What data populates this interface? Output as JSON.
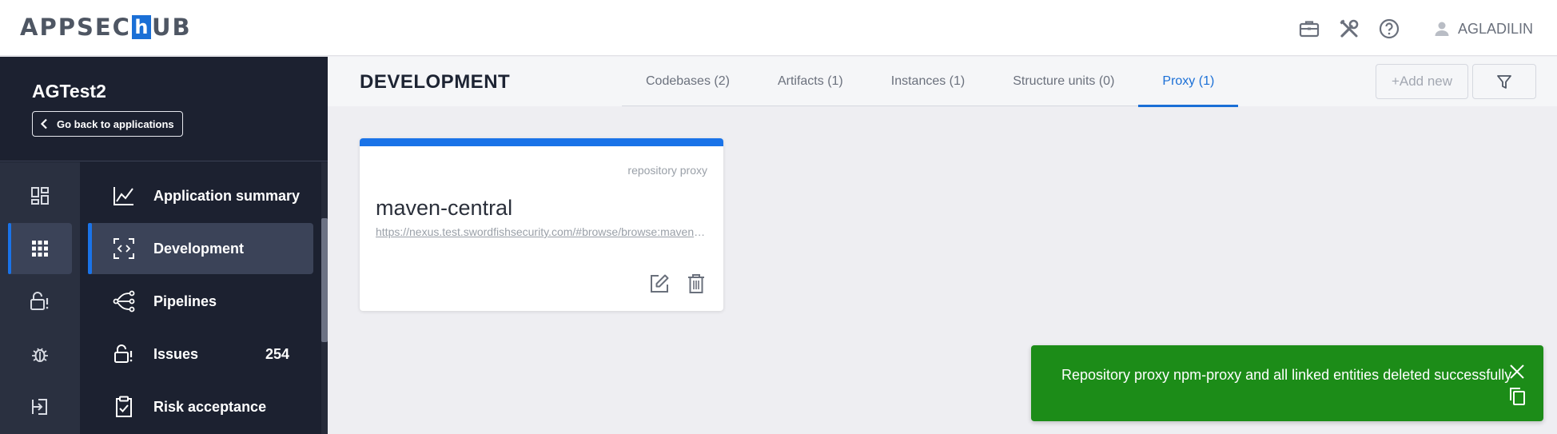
{
  "topbar": {
    "logo_left": "APPSEC",
    "logo_mid": "h",
    "logo_right": "UB",
    "icons": [
      "briefcase-icon",
      "tools-icon",
      "help-icon"
    ],
    "user_name": "AGLADILIN"
  },
  "sidebar": {
    "app_name": "AGTest2",
    "back_label": "Go back to applications",
    "rail": [
      "dashboard-icon",
      "apps-grid-icon",
      "lock-alert-icon",
      "bug-icon",
      "login-icon"
    ],
    "items": [
      {
        "label": "Application summary",
        "icon": "chart-line-icon",
        "count": ""
      },
      {
        "label": "Development",
        "icon": "code-scan-icon",
        "count": ""
      },
      {
        "label": "Pipelines",
        "icon": "pipeline-icon",
        "count": ""
      },
      {
        "label": "Issues",
        "icon": "lock-alert-icon",
        "count": "254"
      },
      {
        "label": "Risk acceptance",
        "icon": "clipboard-check-icon",
        "count": ""
      }
    ],
    "active_index": 1
  },
  "main": {
    "title": "DEVELOPMENT",
    "tabs": [
      {
        "label": "Codebases (2)"
      },
      {
        "label": "Artifacts (1)"
      },
      {
        "label": "Instances (1)"
      },
      {
        "label": "Structure units (0)"
      },
      {
        "label": "Proxy (1)"
      }
    ],
    "active_tab": 4,
    "add_label": "+Add new"
  },
  "card": {
    "type": "repository proxy",
    "name": "maven-central",
    "url": "https://nexus.test.swordfishsecurity.com/#browse/browse:maven-central"
  },
  "toast": {
    "message": "Repository proxy npm-proxy and all linked entities deleted successfully"
  },
  "colors": {
    "accent": "#1a73e8",
    "sidebar_bg": "#1c2130",
    "toast_bg": "#1c8c18"
  }
}
